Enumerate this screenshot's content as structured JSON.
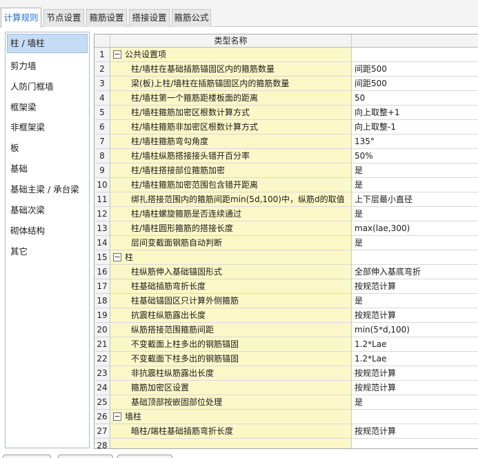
{
  "tabs": [
    {
      "label": "计算规则",
      "active": true
    },
    {
      "label": "节点设置",
      "active": false
    },
    {
      "label": "箍筋设置",
      "active": false
    },
    {
      "label": "搭接设置",
      "active": false
    },
    {
      "label": "箍筋公式",
      "active": false
    }
  ],
  "sidebar": {
    "items": [
      {
        "label": "柱 / 墙柱",
        "selected": true
      },
      {
        "label": "剪力墙"
      },
      {
        "label": "人防门框墙"
      },
      {
        "label": "框架梁"
      },
      {
        "label": "非框架梁"
      },
      {
        "label": "板"
      },
      {
        "label": "基础"
      },
      {
        "label": "基础主梁 / 承台梁"
      },
      {
        "label": "基础次梁"
      },
      {
        "label": "砌体结构"
      },
      {
        "label": "其它"
      }
    ]
  },
  "grid": {
    "header": {
      "type_name": "类型名称"
    },
    "rows": [
      {
        "num": "1",
        "group": true,
        "toggle": "−",
        "name": "公共设置项",
        "value": ""
      },
      {
        "num": "2",
        "name": "柱/墙柱在基础插筋锚固区内的箍筋数量",
        "value": "间距500"
      },
      {
        "num": "3",
        "name": "梁(板)上柱/墙柱在插筋锚固区内的箍筋数量",
        "value": "间距500"
      },
      {
        "num": "4",
        "name": "柱/墙柱第一个箍筋距楼板面的距离",
        "value": "50"
      },
      {
        "num": "5",
        "name": "柱/墙柱箍筋加密区根数计算方式",
        "value": "向上取整+1"
      },
      {
        "num": "6",
        "name": "柱/墙柱箍筋非加密区根数计算方式",
        "value": "向上取整-1"
      },
      {
        "num": "7",
        "name": "柱/墙柱箍筋弯勾角度",
        "value": "135°"
      },
      {
        "num": "8",
        "name": "柱/墙柱纵筋搭接接头错开百分率",
        "value": "50%"
      },
      {
        "num": "9",
        "name": "柱/墙柱搭接部位箍筋加密",
        "value": "是"
      },
      {
        "num": "10",
        "name": "柱/墙柱箍筋加密范围包含错开距离",
        "value": "是"
      },
      {
        "num": "11",
        "name": "绑扎搭接范围内的箍筋间距min(5d,100)中，纵筋d的取值",
        "value": "上下层最小直径"
      },
      {
        "num": "12",
        "name": "柱/墙柱螺旋箍筋是否连续通过",
        "value": "是"
      },
      {
        "num": "13",
        "name": "柱/墙柱圆形箍筋的搭接长度",
        "value": "max(lae,300)"
      },
      {
        "num": "14",
        "name": "层间变截面钢筋自动判断",
        "value": "是"
      },
      {
        "num": "15",
        "group": true,
        "toggle": "−",
        "name": "柱",
        "value": ""
      },
      {
        "num": "16",
        "name": "柱纵筋伸入基础锚固形式",
        "value": "全部伸入基底弯折"
      },
      {
        "num": "17",
        "name": "柱基础插筋弯折长度",
        "value": "按规范计算"
      },
      {
        "num": "18",
        "name": "柱基础锚固区只计算外侧箍筋",
        "value": "是"
      },
      {
        "num": "19",
        "name": "抗震柱纵筋露出长度",
        "value": "按规范计算"
      },
      {
        "num": "20",
        "name": "纵筋搭接范围箍筋间距",
        "value": "min(5*d,100)"
      },
      {
        "num": "21",
        "name": "不变截面上柱多出的钢筋锚固",
        "value": "1.2*Lae"
      },
      {
        "num": "22",
        "name": "不变截面下柱多出的钢筋锚固",
        "value": "1.2*Lae"
      },
      {
        "num": "23",
        "name": "非抗震柱纵筋露出长度",
        "value": "按规范计算"
      },
      {
        "num": "24",
        "name": "箍筋加密区设置",
        "value": "按规范计算"
      },
      {
        "num": "25",
        "name": "基础顶部按嵌固部位处理",
        "value": "是"
      },
      {
        "num": "26",
        "group": true,
        "toggle": "−",
        "name": "墙柱",
        "value": ""
      },
      {
        "num": "27",
        "name": "暗柱/端柱基础插筋弯折长度",
        "value": "按规范计算"
      },
      {
        "num": "28",
        "name": "",
        "value": ""
      }
    ]
  }
}
